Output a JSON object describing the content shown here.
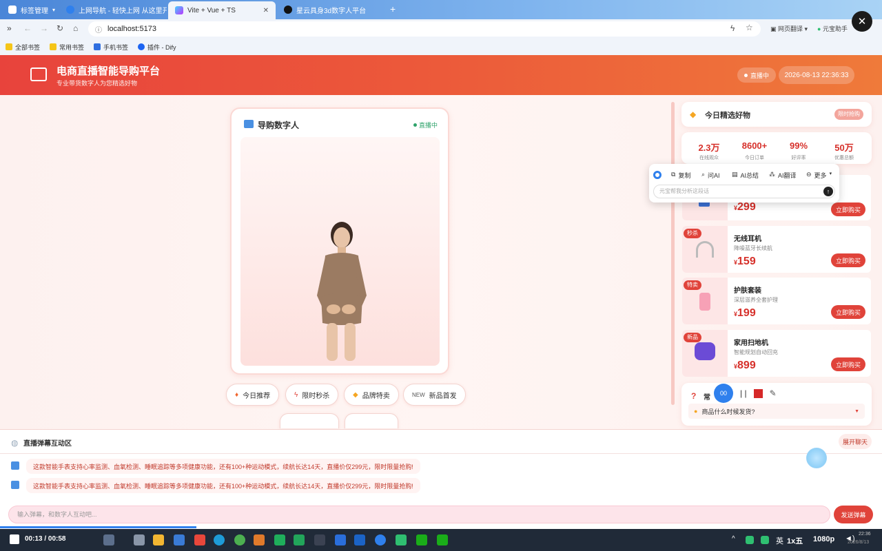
{
  "browser": {
    "tabs": [
      {
        "label": "标签管理"
      },
      {
        "label": "上网导航 - 轻快上网 从这里开始"
      },
      {
        "label": "Vite + Vue + TS"
      },
      {
        "label": "星云具身3d数字人平台"
      }
    ],
    "url": "localhost:5173",
    "translate_label": "网页翻译",
    "assistant_label": "元宝助手",
    "bookmarks": [
      "全部书签",
      "常用书签",
      "手机书签",
      "插件 - Dify"
    ]
  },
  "header": {
    "title": "电商直播智能导购平台",
    "subtitle": "专业带货数字人为您精选好物",
    "live_badge": "直播中",
    "datetime": "2026-08-13 22:36:33"
  },
  "avatar_panel": {
    "title": "导购数字人",
    "status": "直播中"
  },
  "quick_actions": [
    {
      "label": "今日推荐",
      "icon": "fire-icon"
    },
    {
      "label": "限时秒杀",
      "icon": "lightning-icon"
    },
    {
      "label": "品牌特卖",
      "icon": "tag-icon"
    },
    {
      "label": "新品首发",
      "icon": "new-icon"
    }
  ],
  "goods": {
    "title": "今日精选好物",
    "badge": "限时抢购",
    "stats": [
      {
        "value": "2.3万",
        "label": "在线观众"
      },
      {
        "value": "8600+",
        "label": "今日订单"
      },
      {
        "value": "99%",
        "label": "好评率"
      },
      {
        "value": "50万",
        "label": "优惠总额"
      }
    ],
    "partial_price": "299",
    "currency": "¥",
    "buy_label": "立即购买",
    "products": [
      {
        "tag": "秒杀",
        "name": "无线耳机",
        "desc": "降噪蓝牙长续航",
        "price": "159"
      },
      {
        "tag": "特卖",
        "name": "护肤套装",
        "desc": "深层滋养全套护理",
        "price": "199"
      },
      {
        "tag": "新品",
        "name": "家用扫地机",
        "desc": "智能规划自动回充",
        "price": "899"
      }
    ],
    "faq_title_partial": "常",
    "faq_item": "商品什么时候发货?"
  },
  "popup": {
    "copy": "复制",
    "ask_ai": "问AI",
    "ai_summary": "AI总结",
    "ai_translate": "AI翻译",
    "more": "更多",
    "placeholder": "元宝帮我分析这段话"
  },
  "recorder": {
    "time_partial": "00"
  },
  "chat": {
    "title": "直播弹幕互动区",
    "expand_label": "展开聊天",
    "messages": [
      "这款智能手表支持心率监测、血氧检测、睡眠追踪等多项健康功能，还有100+种运动模式，续航长达14天，直播价仅299元，限时限量抢购!",
      "这款智能手表支持心率监测、血氧检测、睡眠追踪等多项健康功能，还有100+种运动模式，续航长达14天，直播价仅299元，限时限量抢购!"
    ],
    "input_placeholder": "输入弹幕，和数字人互动吧...",
    "send_label": "发送弹幕"
  },
  "player": {
    "time": "00:13 / 00:58",
    "speed": "1x五",
    "quality": "1080p",
    "lang": "英",
    "clock_time": "22:36",
    "clock_date": "2026/8/13"
  },
  "colors": {
    "brand_red": "#e0433a",
    "header_gradient_end": "#ef7a3a"
  }
}
